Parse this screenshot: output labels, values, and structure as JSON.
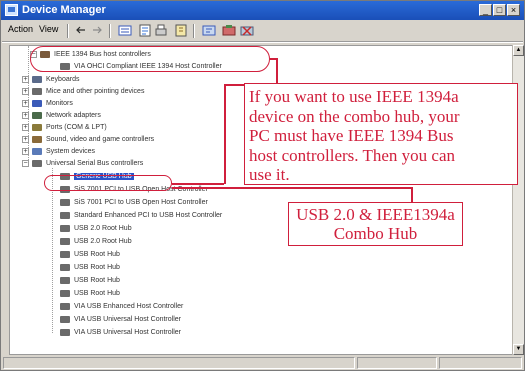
{
  "window": {
    "title": "Device Manager"
  },
  "menu": {
    "action": "Action",
    "view": "View"
  },
  "tree": {
    "items": [
      {
        "text": "IEEE 1394 Bus host controllers",
        "color": "#7a5a3c"
      },
      {
        "text": "VIA OHCI Compliant IEEE 1394 Host Controller",
        "color": "#6a6a6a"
      },
      {
        "text": "Keyboards",
        "color": "#5a6a8a"
      },
      {
        "text": "Mice and other pointing devices",
        "color": "#6a6a6a"
      },
      {
        "text": "Monitors",
        "color": "#3a5ab8"
      },
      {
        "text": "Network adapters",
        "color": "#4a6a4a"
      },
      {
        "text": "Ports (COM & LPT)",
        "color": "#8a7a3a"
      },
      {
        "text": "Sound, video and game controllers",
        "color": "#8a6a3a"
      },
      {
        "text": "System devices",
        "color": "#5a7ab8"
      },
      {
        "text": "Universal Serial Bus controllers",
        "color": "#6a6a6a"
      },
      {
        "text": "Generic USB Hub",
        "color": "#6a6a6a"
      },
      {
        "text": "SiS 7001 PCI to USB Open Host Controller",
        "color": "#6a6a6a"
      },
      {
        "text": "SiS 7001 PCI to USB Open Host Controller",
        "color": "#6a6a6a"
      },
      {
        "text": "Standard Enhanced PCI to USB Host Controller",
        "color": "#6a6a6a"
      },
      {
        "text": "USB 2.0 Root Hub",
        "color": "#6a6a6a"
      },
      {
        "text": "USB 2.0 Root Hub",
        "color": "#6a6a6a"
      },
      {
        "text": "USB Root Hub",
        "color": "#6a6a6a"
      },
      {
        "text": "USB Root Hub",
        "color": "#6a6a6a"
      },
      {
        "text": "USB Root Hub",
        "color": "#6a6a6a"
      },
      {
        "text": "USB Root Hub",
        "color": "#6a6a6a"
      },
      {
        "text": "VIA USB Enhanced Host Controller",
        "color": "#6a6a6a"
      },
      {
        "text": "VIA USB Universal Host Controller",
        "color": "#6a6a6a"
      },
      {
        "text": "VIA USB Universal Host Controller",
        "color": "#6a6a6a"
      }
    ]
  },
  "annotations": {
    "callout1_lines": [
      "If you want to use IEEE 1394a",
      "device on the combo hub, your",
      "PC must have IEEE 1394 Bus",
      "host controllers. Then you can",
      "use it."
    ],
    "callout2_lines": [
      "USB 2.0 & IEEE1394a",
      "Combo Hub"
    ],
    "color": "#d01f3c"
  },
  "icons": [
    "device-manager-icon",
    "back-arrow-icon",
    "forward-arrow-icon",
    "properties-icon",
    "scan-hardware-icon",
    "update-driver-icon",
    "uninstall-icon",
    "disable-icon"
  ]
}
